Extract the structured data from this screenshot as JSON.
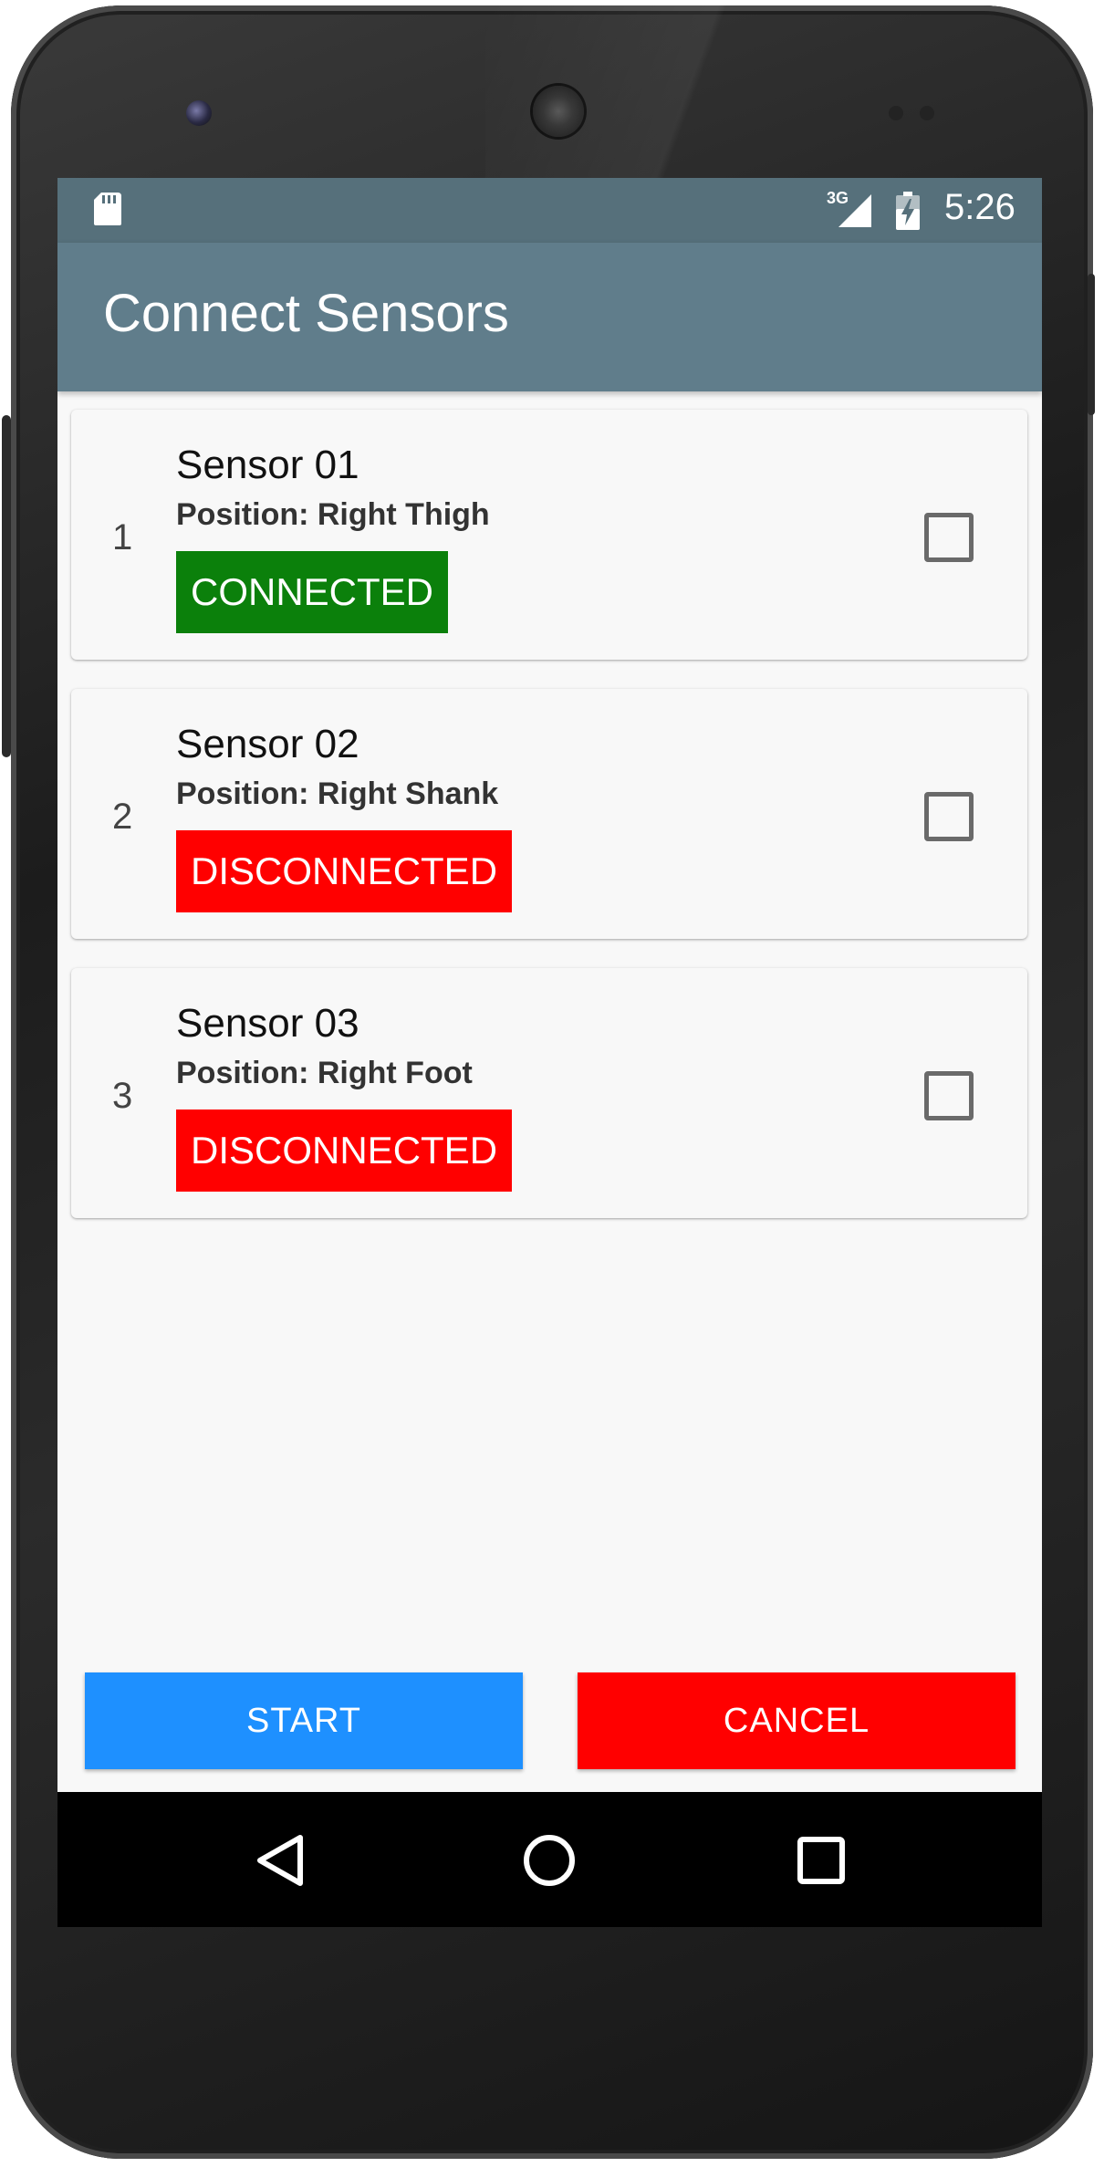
{
  "status_bar": {
    "network_label": "3G",
    "time": "5:26",
    "icons": [
      "sd-card-icon",
      "cell-signal-icon",
      "battery-charging-icon"
    ]
  },
  "app_bar": {
    "title": "Connect Sensors"
  },
  "sensors": [
    {
      "index": "1",
      "name": "Sensor 01",
      "position": "Position: Right Thigh",
      "status": "CONNECTED",
      "checked": false
    },
    {
      "index": "2",
      "name": "Sensor 02",
      "position": "Position: Right Shank",
      "status": "DISCONNECTED",
      "checked": false
    },
    {
      "index": "3",
      "name": "Sensor 03",
      "position": "Position: Right Foot",
      "status": "DISCONNECTED",
      "checked": false
    }
  ],
  "actions": {
    "start_label": "START",
    "cancel_label": "CANCEL"
  },
  "nav_bar": {
    "icons": [
      "back-icon",
      "home-icon",
      "recents-icon"
    ]
  },
  "colors": {
    "status_bar": "#56707b",
    "app_bar": "#607d8b",
    "connected": "#0b800b",
    "disconnected": "#ff0000",
    "start_button": "#1e90ff",
    "cancel_button": "#ff0000"
  }
}
